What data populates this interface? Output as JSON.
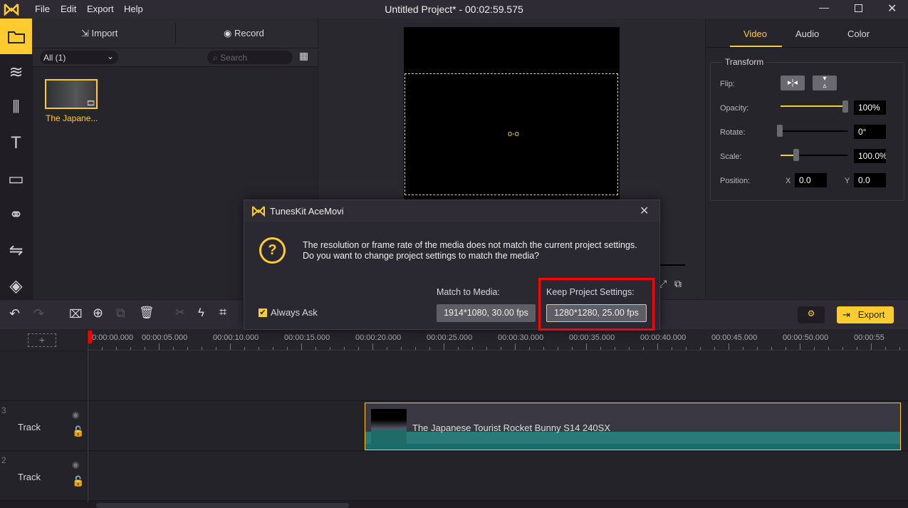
{
  "app": {
    "title": "Untitled Project* - 00:02:59.575",
    "menu": [
      "File",
      "Edit",
      "Export",
      "Help"
    ],
    "accent": "#ffcb2f"
  },
  "sidebar": {
    "items": [
      "media-folder",
      "layers",
      "audio",
      "text",
      "templates",
      "filters",
      "transitions",
      "elements"
    ]
  },
  "media": {
    "import_label": "Import",
    "record_label": "Record",
    "filter": "All (1)",
    "search_placeholder": "Search",
    "items": [
      {
        "name": "The Japane..."
      }
    ]
  },
  "props": {
    "tabs": [
      "Video",
      "Audio",
      "Color"
    ],
    "active_tab": "Video",
    "section": "Transform",
    "flip_label": "Flip:",
    "opacity_label": "Opacity:",
    "opacity": "100%",
    "opacity_value": 1.0,
    "rotate_label": "Rotate:",
    "rotate": "0°",
    "rotate_value": 0,
    "scale_label": "Scale:",
    "scale": "100.0%",
    "scale_value": 0.22,
    "position_label": "Position:",
    "x_label": "X",
    "x": "0.0",
    "y_label": "Y",
    "y": "0.0"
  },
  "toolbar": {
    "export_label": "Export"
  },
  "timeline": {
    "ticks": [
      "0:00:00.000",
      "00:00:05.000",
      "00:00:10.000",
      "00:00:15.000",
      "00:00:20.000",
      "00:00:25.000",
      "00:00:30.000",
      "00:00:35.000",
      "00:00:40.000",
      "00:00:45.000",
      "00:00:50.000",
      "00:00:55"
    ],
    "tracks": [
      {
        "num": "3",
        "label": "Track"
      },
      {
        "num": "2",
        "label": "Track"
      }
    ],
    "clip": "The Japanese Tourist Rocket Bunny S14 240SX"
  },
  "dialog": {
    "title": "TunesKit AceMovi",
    "message": "The resolution or frame rate of the media does not match the current project settings. Do you want to change project settings to match the media?",
    "always_ask": "Always Ask",
    "always_ask_checked": true,
    "match_label": "Match to Media:",
    "match_value": "1914*1080, 30.00 fps",
    "keep_label": "Keep Project Settings:",
    "keep_value": "1280*1280, 25.00 fps",
    "highlight": "#ff0000"
  }
}
